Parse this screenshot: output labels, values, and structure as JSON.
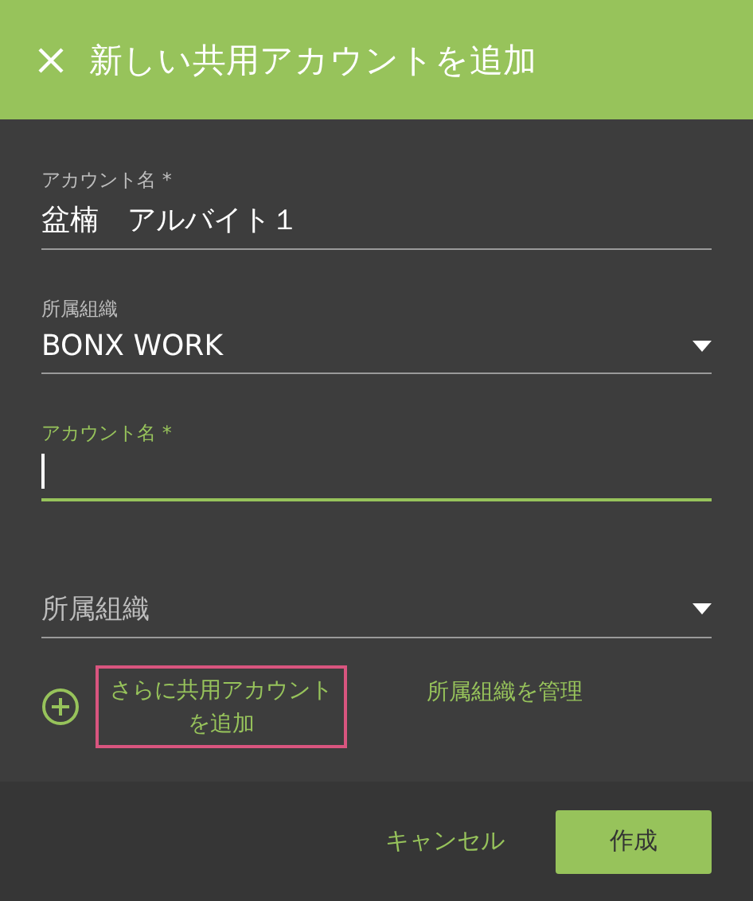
{
  "header": {
    "title": "新しい共用アカウントを追加"
  },
  "fields": [
    {
      "kind": "text",
      "label": "アカウント名 *",
      "value": "盆楠　アルバイト１",
      "focused": false
    },
    {
      "kind": "select",
      "label": "所属組織",
      "value": "BONX WORK",
      "focused": false
    },
    {
      "kind": "text",
      "label": "アカウント名 *",
      "focused": true
    },
    {
      "kind": "select",
      "placeholder": "所属組織",
      "focused": false
    }
  ],
  "links": {
    "add_more": {
      "label": "さらに共用アカウントを追加",
      "highlighted": true
    },
    "manage": "所属組織を管理"
  },
  "footer": {
    "cancel": "キャンセル",
    "create": "作成"
  }
}
